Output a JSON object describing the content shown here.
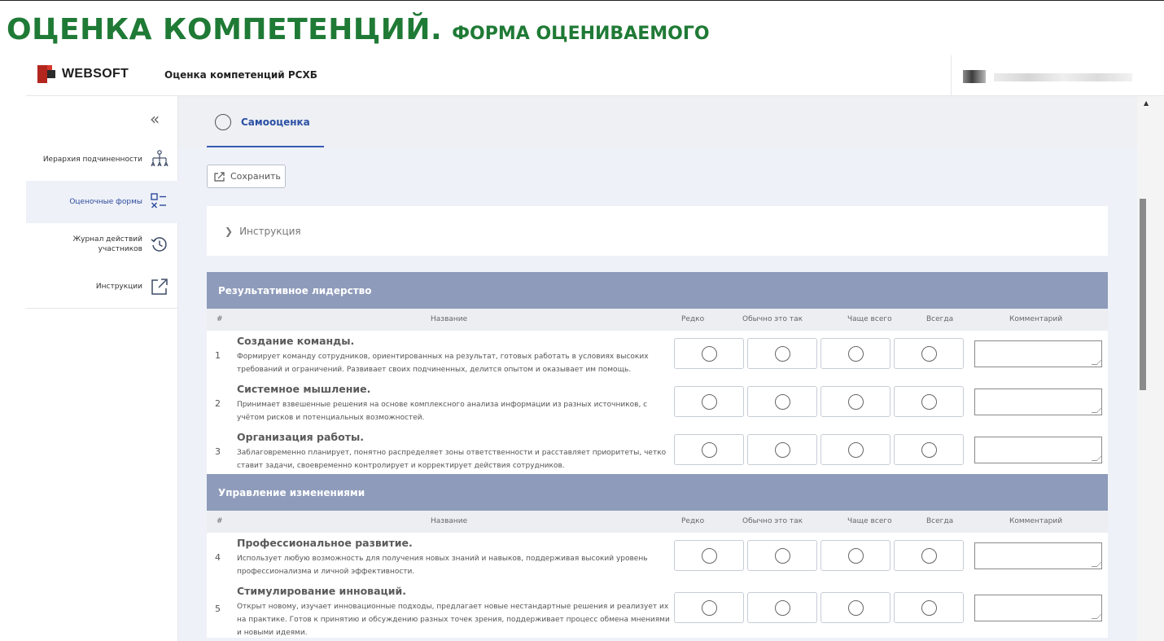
{
  "slide": {
    "title_main": "ОЦЕНКА КОМПЕТЕНЦИЙ.",
    "title_sub": "ФОРМА ОЦЕНИВАЕМОГО"
  },
  "header": {
    "logo_text": "WEBSOFT",
    "app_title": "Оценка компетенций РСХБ"
  },
  "sidebar": {
    "collapse_icon": "«",
    "items": [
      {
        "label": "Иерархия подчиненности",
        "icon": "hierarchy-icon",
        "active": false
      },
      {
        "label": "Оценочные формы",
        "icon": "checklist-icon",
        "active": true
      },
      {
        "label": "Журнал действий участников",
        "icon": "history-icon",
        "active": false
      },
      {
        "label": "Инструкции",
        "icon": "external-link-icon",
        "active": false
      }
    ]
  },
  "main": {
    "tab_label": "Самооценка",
    "save_label": "Сохранить",
    "instruction_label": "Инструкция"
  },
  "columns": {
    "num": "#",
    "name": "Название",
    "rarely": "Редко",
    "usually": "Обычно это так",
    "mostly": "Чаще всего",
    "always": "Всегда",
    "comment": "Комментарий"
  },
  "sections": [
    {
      "title": "Результативное лидерство",
      "rows": [
        {
          "num": "1",
          "title": "Создание команды.",
          "desc": "Формирует команду сотрудников, ориентированных на результат, готовых работать в условиях высоких требований и ограничений. Развивает своих подчиненных, делится опытом и оказывает им помощь."
        },
        {
          "num": "2",
          "title": "Системное мышление.",
          "desc": "Принимает взвешенные решения на основе комплексного анализа информации из разных источников, с учётом рисков и потенциальных возможностей."
        },
        {
          "num": "3",
          "title": "Организация работы.",
          "desc": "Заблаговременно планирует, понятно распределяет зоны ответственности и расставляет приоритеты, четко ставит задачи, своевременно контролирует и корректирует действия сотрудников."
        }
      ]
    },
    {
      "title": "Управление изменениями",
      "rows": [
        {
          "num": "4",
          "title": "Профессиональное развитие.",
          "desc": "Использует любую возможность для получения новых знаний и навыков, поддерживая высокий уровень профессионализма и личной эффективности."
        },
        {
          "num": "5",
          "title": "Стимулирование инноваций.",
          "desc": "Открыт новому, изучает инновационные подходы, предлагает новые нестандартные решения и реализует их на практике. Готов к принятию и обсуждению разных точек зрения, поддерживает процесс обмена мнениями и новыми идеями."
        }
      ]
    }
  ],
  "colors": {
    "brand_green": "#1f7a35",
    "section_header": "#8e9bba",
    "accent_blue": "#3b5bb5"
  }
}
